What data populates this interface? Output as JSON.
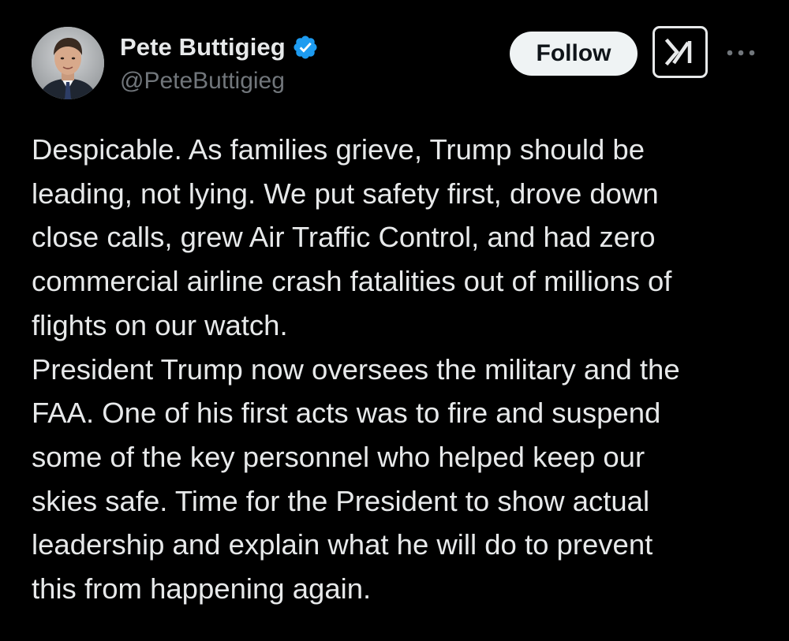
{
  "author": {
    "display_name": "Pete Buttigieg",
    "handle": "@PeteButtigieg",
    "verified": true,
    "verified_color": "#1d9bf0"
  },
  "actions": {
    "follow_label": "Follow",
    "grok_icon": "grok-icon",
    "more_icon": "more-icon"
  },
  "tweet": {
    "lines": [
      "Despicable. As families grieve, Trump should be",
      "leading, not lying. We put safety first, drove down",
      "close calls, grew Air Traffic Control, and had zero",
      "commercial airline crash fatalities out of millions of",
      "flights on our watch.",
      "President Trump now oversees the military and the",
      "FAA. One of his first acts was to fire and suspend",
      "some of the key personnel who helped keep our",
      "skies safe. Time for the President to show actual",
      "leadership and explain what he will do to prevent",
      "this from happening again."
    ]
  },
  "colors": {
    "background": "#000000",
    "text": "#e7e9ea",
    "secondary_text": "#71767b",
    "follow_bg": "#eff3f4"
  }
}
